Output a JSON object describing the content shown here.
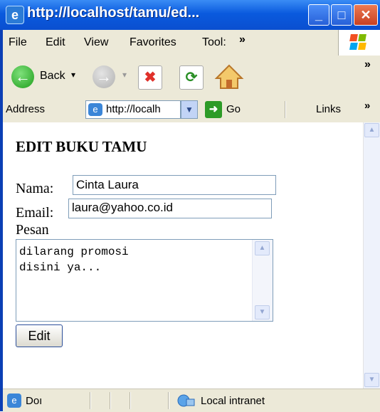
{
  "window": {
    "title": "http://localhost/tamu/ed...",
    "icons": [
      "ie-page-icon",
      "minimize-icon",
      "maximize-icon",
      "close-icon"
    ]
  },
  "menubar": {
    "items": [
      "File",
      "Edit",
      "View",
      "Favorites",
      "Tool:"
    ],
    "overflow": "»"
  },
  "toolbar": {
    "back_label": "Back",
    "dropdown": "▾",
    "overflow": "»"
  },
  "addressbar": {
    "label": "Address",
    "url": "http://localh",
    "go_label": "Go",
    "links_label": "Links",
    "overflow": "»"
  },
  "page": {
    "heading": "EDIT BUKU TAMU",
    "nama_label": "Nama:",
    "nama_value": "Cinta Laura",
    "email_label": "Email:",
    "email_value": "laura@yahoo.co.id",
    "pesan_label": "Pesan",
    "pesan_value": "dilarang promosi\ndisini ya...",
    "edit_button": "Edit"
  },
  "statusbar": {
    "status_text": "Doı",
    "zone_text": "Local intranet"
  },
  "colors": {
    "titlebar": "#0a5ade",
    "chrome": "#ece9d8",
    "input_border": "#7f9db9"
  }
}
